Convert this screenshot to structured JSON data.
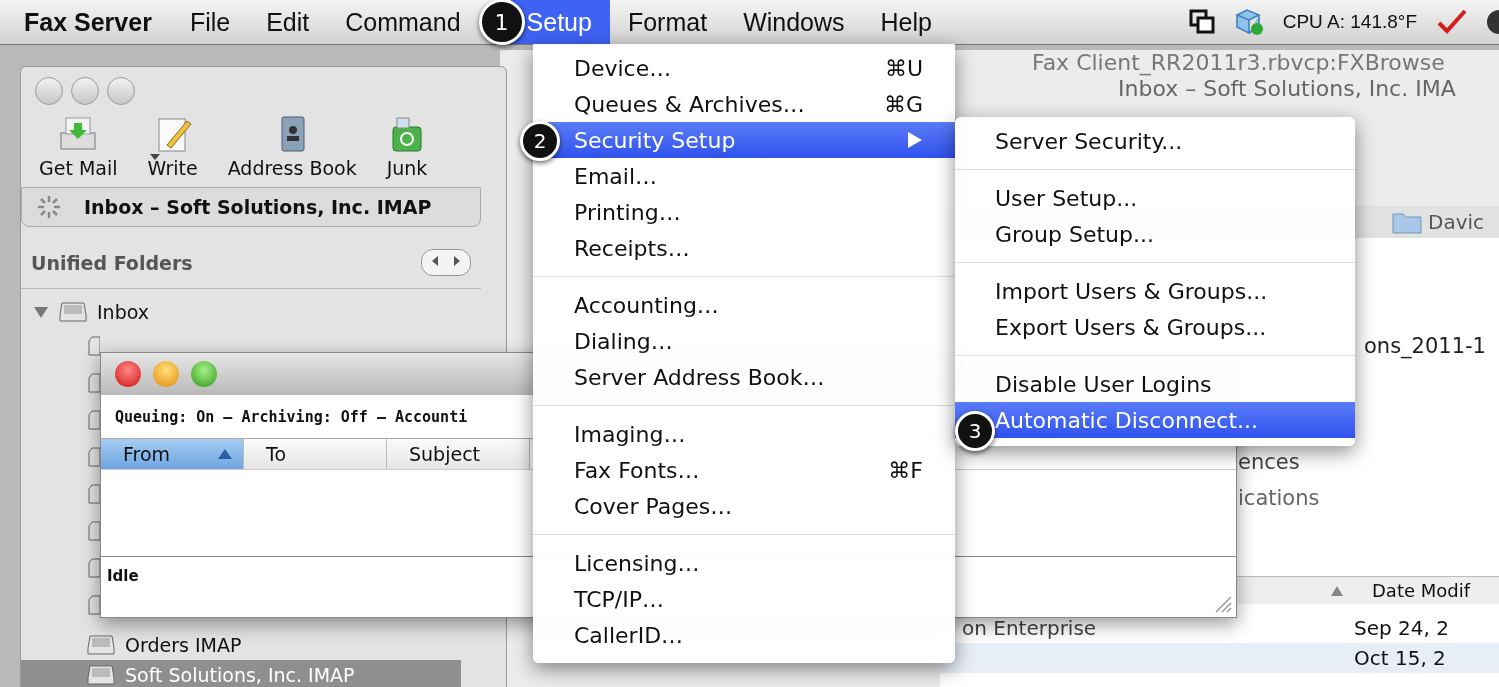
{
  "menu_bar": {
    "app": "Fax Server",
    "items": [
      {
        "label": "File",
        "selected": false
      },
      {
        "label": "Edit",
        "selected": false
      },
      {
        "label": "Command",
        "selected": false
      },
      {
        "label": "Setup",
        "selected": true
      },
      {
        "label": "Format",
        "selected": false
      },
      {
        "label": "Windows",
        "selected": false
      },
      {
        "label": "Help",
        "selected": false
      }
    ],
    "cpu": "CPU A: 141.8°F"
  },
  "step_badges": [
    "1",
    "2",
    "3"
  ],
  "setup_menu": [
    [
      {
        "label": "Device…",
        "shortcut": "⌘U",
        "selected": false,
        "submenu": false
      },
      {
        "label": "Queues & Archives…",
        "shortcut": "⌘G",
        "selected": false,
        "submenu": false
      },
      {
        "label": "Security Setup",
        "selected": true,
        "submenu": true
      },
      {
        "label": "Email…",
        "selected": false,
        "submenu": false
      },
      {
        "label": "Printing…",
        "selected": false,
        "submenu": false
      },
      {
        "label": "Receipts…",
        "selected": false,
        "submenu": false
      }
    ],
    [
      {
        "label": "Accounting…",
        "selected": false,
        "submenu": false
      },
      {
        "label": "Dialing…",
        "selected": false,
        "submenu": false
      },
      {
        "label": "Server Address Book…",
        "selected": false,
        "submenu": false
      }
    ],
    [
      {
        "label": "Imaging…",
        "selected": false,
        "submenu": false
      },
      {
        "label": "Fax Fonts…",
        "shortcut": "⌘F",
        "selected": false,
        "submenu": false
      },
      {
        "label": "Cover Pages…",
        "selected": false,
        "submenu": false
      }
    ],
    [
      {
        "label": "Licensing…",
        "selected": false,
        "submenu": false
      },
      {
        "label": "TCP/IP…",
        "selected": false,
        "submenu": false
      },
      {
        "label": "CallerID…",
        "selected": false,
        "submenu": false
      }
    ]
  ],
  "security_submenu": [
    [
      {
        "label": "Server Security...",
        "selected": false
      }
    ],
    [
      {
        "label": "User Setup...",
        "selected": false
      },
      {
        "label": "Group Setup...",
        "selected": false
      }
    ],
    [
      {
        "label": "Import Users & Groups...",
        "selected": false
      },
      {
        "label": "Export Users & Groups...",
        "selected": false
      }
    ],
    [
      {
        "label": "Disable User Logins",
        "selected": false
      },
      {
        "label": "Automatic Disconnect...",
        "selected": true
      }
    ]
  ],
  "mail_window": {
    "toolbar": [
      {
        "label": "Get Mail",
        "kind": "getmail"
      },
      {
        "label": "Write",
        "kind": "write"
      },
      {
        "label": "Address Book",
        "kind": "addressbook"
      },
      {
        "label": "Junk",
        "kind": "junk"
      }
    ],
    "tab": "Inbox – Soft Solutions, Inc. IMAP",
    "sidebar_title": "Unified Folders",
    "folders": [
      {
        "label": "Inbox",
        "expanded": true,
        "selected": false
      },
      {
        "label": "Orders IMAP",
        "selected": false
      },
      {
        "label": "Soft Solutions, Inc. IMAP",
        "selected": true
      }
    ]
  },
  "queue_window": {
    "status_line": "Queuing: On – Archiving: Off – Accounti",
    "columns": [
      {
        "label": "From",
        "selected": true
      },
      {
        "label": "To",
        "selected": false
      },
      {
        "label": "Subject",
        "selected": false
      }
    ],
    "status": "Idle"
  },
  "background_window": {
    "document_title": "Fax Client_RR2011r3.rbvcp:FXBrowse",
    "title": "Inbox – Soft Solutions, Inc. IMA",
    "folder": "Davic",
    "rows": [
      "ons_2011-1",
      "ences",
      "ications"
    ],
    "column": "Date Modif",
    "file_rows": [
      {
        "name": "on Enterprise",
        "date": "Sep 24, 2"
      },
      {
        "name": "",
        "date": "Oct 15, 2"
      }
    ]
  }
}
